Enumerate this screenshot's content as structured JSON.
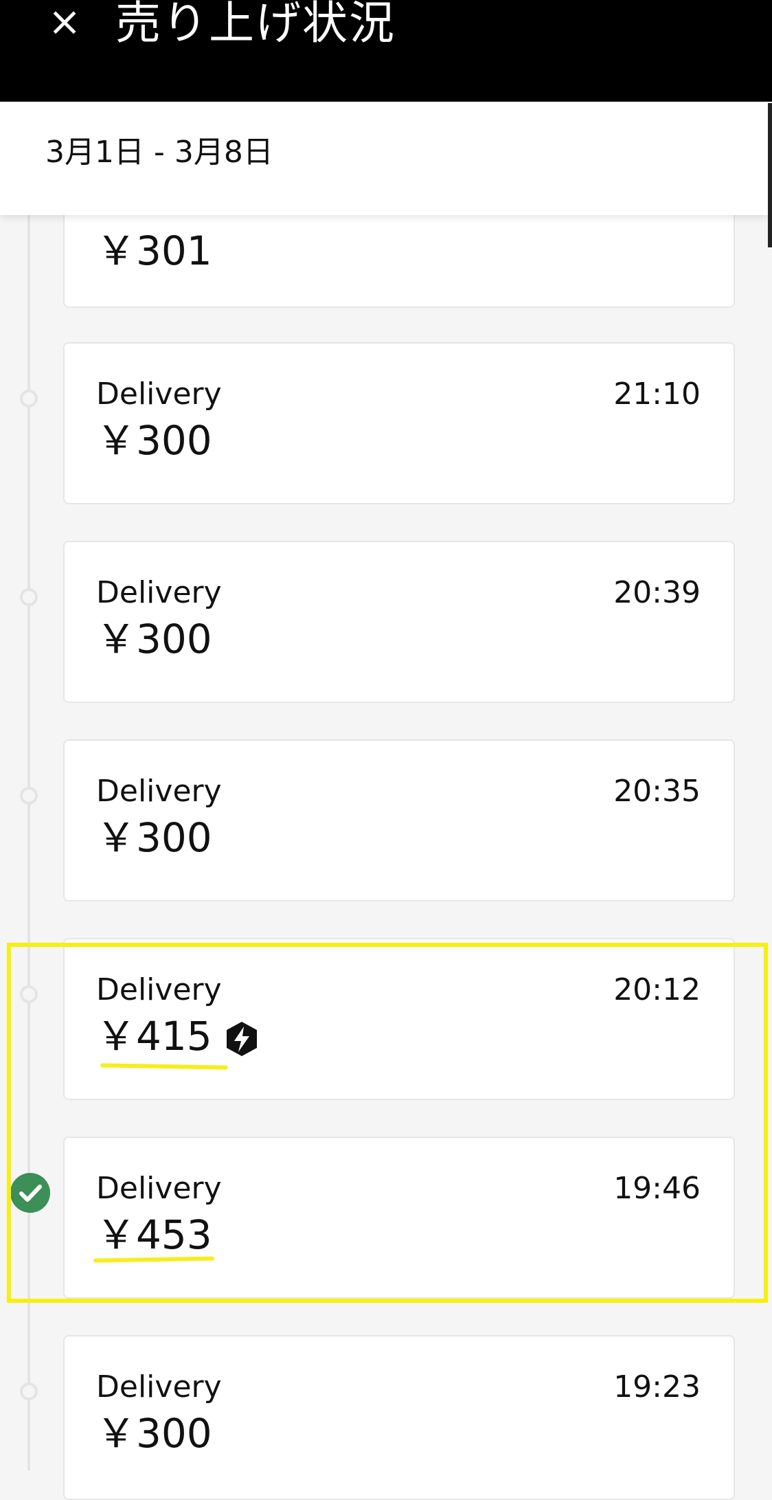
{
  "header": {
    "close_icon": "close-icon",
    "close_glyph": "×",
    "title": "売り上げ状況"
  },
  "date_range": "3月1日 - 3月8日",
  "cards": [
    {
      "label": "",
      "time": "",
      "amount": "￥301"
    },
    {
      "label": "Delivery",
      "time": "21:10",
      "amount": "￥300"
    },
    {
      "label": "Delivery",
      "time": "20:39",
      "amount": "￥300"
    },
    {
      "label": "Delivery",
      "time": "20:35",
      "amount": "￥300"
    },
    {
      "label": "Delivery",
      "time": "20:12",
      "amount": "￥415",
      "boost_icon": "lightning-hexagon-icon"
    },
    {
      "label": "Delivery",
      "time": "19:46",
      "amount": "￥453",
      "status": "check-icon"
    },
    {
      "label": "Delivery",
      "time": "19:23",
      "amount": "￥300"
    }
  ],
  "colors": {
    "header_bg": "#000000",
    "highlight": "#f7ef0f",
    "underline": "#f5ee1e",
    "check": "#3b8f57"
  }
}
